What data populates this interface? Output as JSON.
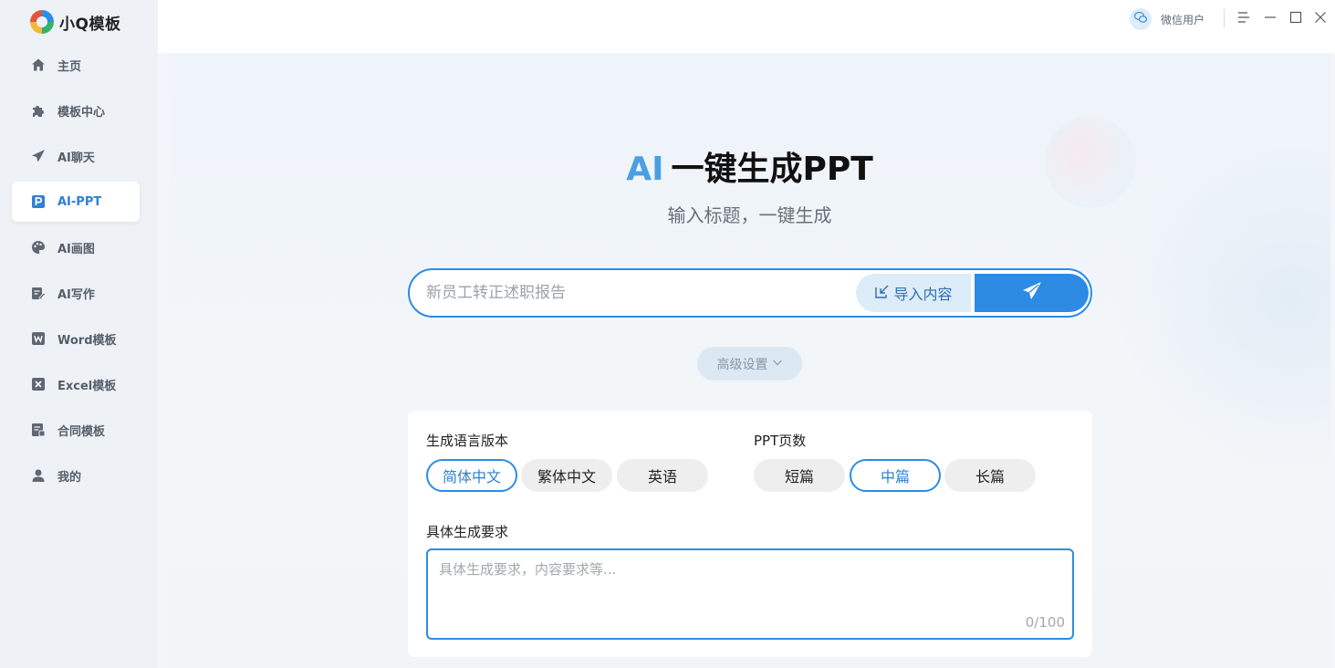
{
  "app": {
    "name": "小Q模板"
  },
  "sidebar": {
    "items": [
      {
        "label": "主页",
        "icon": "home-icon",
        "active": false
      },
      {
        "label": "模板中心",
        "icon": "puzzle-icon",
        "active": false
      },
      {
        "label": "AI聊天",
        "icon": "paper-plane-icon",
        "active": false
      },
      {
        "label": "AI-PPT",
        "icon": "ppt-icon",
        "active": true
      },
      {
        "label": "AI画图",
        "icon": "palette-icon",
        "active": false
      },
      {
        "label": "AI写作",
        "icon": "edit-doc-icon",
        "active": false
      },
      {
        "label": "Word模板",
        "icon": "word-icon",
        "active": false
      },
      {
        "label": "Excel模板",
        "icon": "excel-icon",
        "active": false
      },
      {
        "label": "合同模板",
        "icon": "contract-icon",
        "active": false
      },
      {
        "label": "我的",
        "icon": "user-icon",
        "active": false
      }
    ]
  },
  "topbar": {
    "user_name": "微信用户",
    "window_controls": [
      "menu-icon",
      "minimize-icon",
      "maximize-icon",
      "close-icon"
    ]
  },
  "hero": {
    "title_ai": "AI",
    "title_rest": "一键生成PPT",
    "subtitle": "输入标题，一键生成"
  },
  "search": {
    "placeholder": "新员工转正述职报告",
    "import_label": "导入内容"
  },
  "advanced": {
    "label": "高级设置"
  },
  "settings": {
    "language_label": "生成语言版本",
    "language_options": [
      "简体中文",
      "繁体中文",
      "英语"
    ],
    "language_selected": 0,
    "pages_label": "PPT页数",
    "pages_options": [
      "短篇",
      "中篇",
      "长篇"
    ],
    "pages_selected": 1,
    "requirements_label": "具体生成要求",
    "requirements_placeholder": "具体生成要求，内容要求等...",
    "requirements_count": "0/100"
  },
  "colors": {
    "accent": "#2e8be4",
    "sidebar_bg": "#eef2f6",
    "active_text": "#2f7fd6"
  }
}
